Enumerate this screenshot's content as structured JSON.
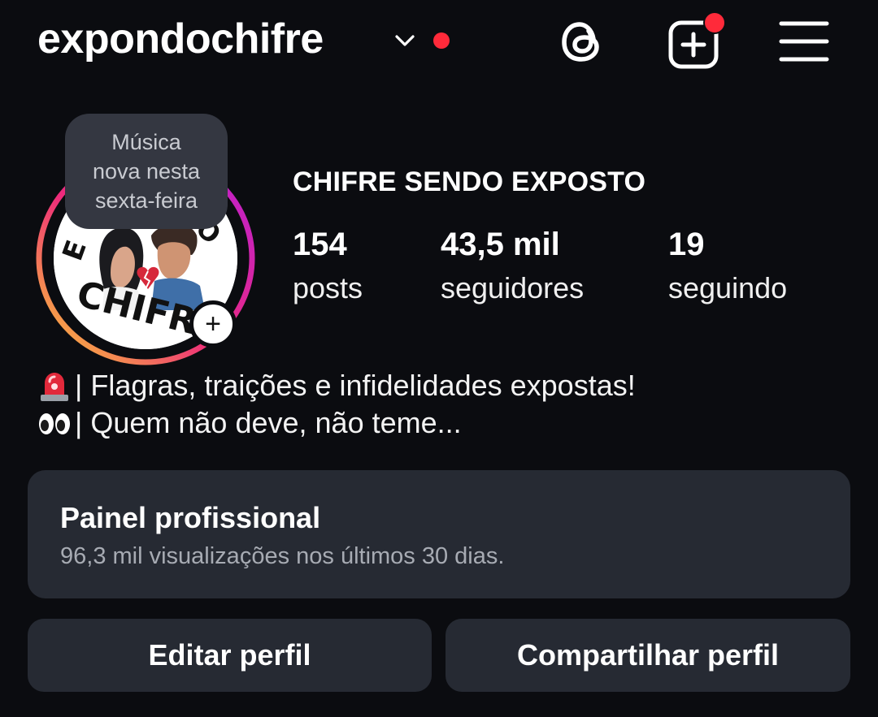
{
  "header": {
    "username": "expondochifre",
    "icons": [
      "chevron-down-icon",
      "notification-dot",
      "threads-icon",
      "add-content-icon",
      "menu-icon"
    ]
  },
  "profile": {
    "note": [
      "Música",
      "nova nesta",
      "sexta-feira"
    ],
    "display_name": "CHIFRE SENDO EXPOSTO",
    "avatar_text": "EXPONDO CHIFRE",
    "stats": [
      {
        "value": "154",
        "label": "posts"
      },
      {
        "value": "43,5 mil",
        "label": "seguidores"
      },
      {
        "value": "19",
        "label": "seguindo"
      }
    ]
  },
  "bio": {
    "lines": [
      {
        "emoji": "🚨",
        "emoji_name": "siren-emoji",
        "text": "| Flagras, traições e infidelidades expostas!"
      },
      {
        "emoji": "👀",
        "emoji_name": "eyes-emoji",
        "text": "| Quem não deve, não teme..."
      }
    ]
  },
  "professional_panel": {
    "title": "Painel profissional",
    "subtitle": "96,3 mil visualizações nos últimos 30 dias."
  },
  "actions": {
    "edit_label": "Editar perfil",
    "share_label": "Compartilhar perfil"
  },
  "colors": {
    "background": "#0b0c10",
    "card": "#262a33",
    "note_bubble": "#343741",
    "notification": "#ff2a3a",
    "story_ring_start": "#f9ce34",
    "story_ring_mid": "#ee2a7b",
    "story_ring_end": "#6228d7"
  }
}
